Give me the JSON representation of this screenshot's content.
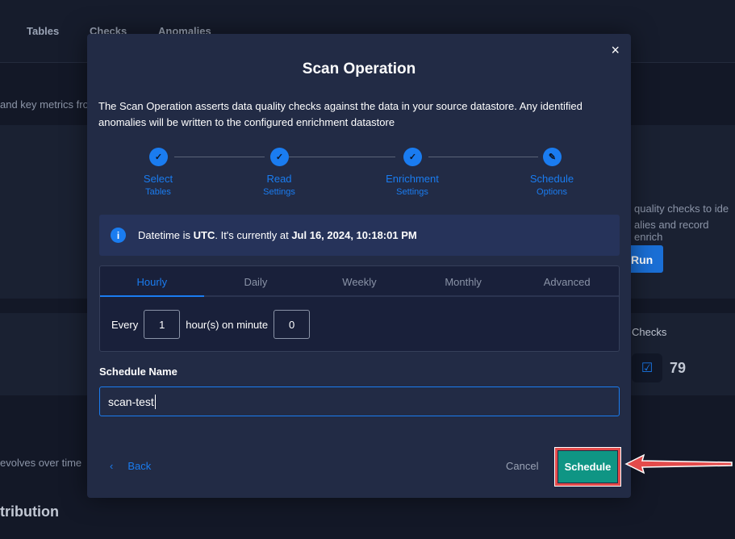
{
  "background": {
    "tabs": [
      "Tables",
      "Checks",
      "Anomalies"
    ],
    "text_left_1": "and key metrics fro",
    "text_right_1": "quality checks to ide",
    "text_right_2": "alies and record enrich",
    "run_label": "Run",
    "checks_label": "Checks",
    "checks_count": "79",
    "text_left_2": "evolves over time",
    "heading_bottom": "tribution"
  },
  "modal": {
    "title": "Scan Operation",
    "close": "×",
    "description": "The Scan Operation asserts data quality checks against the data in your source datastore. Any identified anomalies will be written to the configured enrichment datastore",
    "steps": [
      {
        "title": "Select",
        "sub": "Tables",
        "icon": "check"
      },
      {
        "title": "Read",
        "sub": "Settings",
        "icon": "check"
      },
      {
        "title": "Enrichment",
        "sub": "Settings",
        "icon": "check"
      },
      {
        "title": "Schedule",
        "sub": "Options",
        "icon": "pencil"
      }
    ],
    "info": {
      "pre": "Datetime is ",
      "tz": "UTC",
      "mid": ". It's currently at ",
      "datetime": "Jul 16, 2024, 10:18:01 PM"
    },
    "schedule_tabs": [
      "Hourly",
      "Daily",
      "Weekly",
      "Monthly",
      "Advanced"
    ],
    "active_tab": "Hourly",
    "hourly": {
      "every_label": "Every",
      "every_value": "1",
      "on_minute_label": "hour(s) on minute",
      "minute_value": "0"
    },
    "schedule_name_label": "Schedule Name",
    "schedule_name_value": "scan-test",
    "back_label": "Back",
    "cancel_label": "Cancel",
    "schedule_label": "Schedule"
  },
  "colors": {
    "accent": "#1a7cf0",
    "schedule_button": "#0f9584",
    "highlight": "#e34b4b"
  }
}
